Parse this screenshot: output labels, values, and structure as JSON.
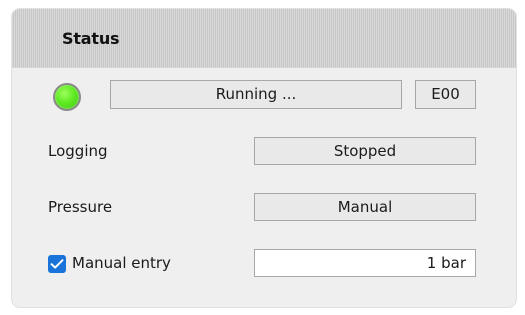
{
  "panel": {
    "title": "Status"
  },
  "status": {
    "indicator_color": "#5fea22",
    "state_text": "Running ...",
    "error_code": "E00"
  },
  "rows": {
    "logging": {
      "label": "Logging",
      "value": "Stopped"
    },
    "pressure": {
      "label": "Pressure",
      "value": "Manual"
    },
    "manual_entry": {
      "label": "Manual entry",
      "checked": true,
      "value": "1 bar"
    }
  },
  "icons": {
    "indicator": "status-led-icon",
    "checkbox": "checkbox-checked-icon"
  }
}
